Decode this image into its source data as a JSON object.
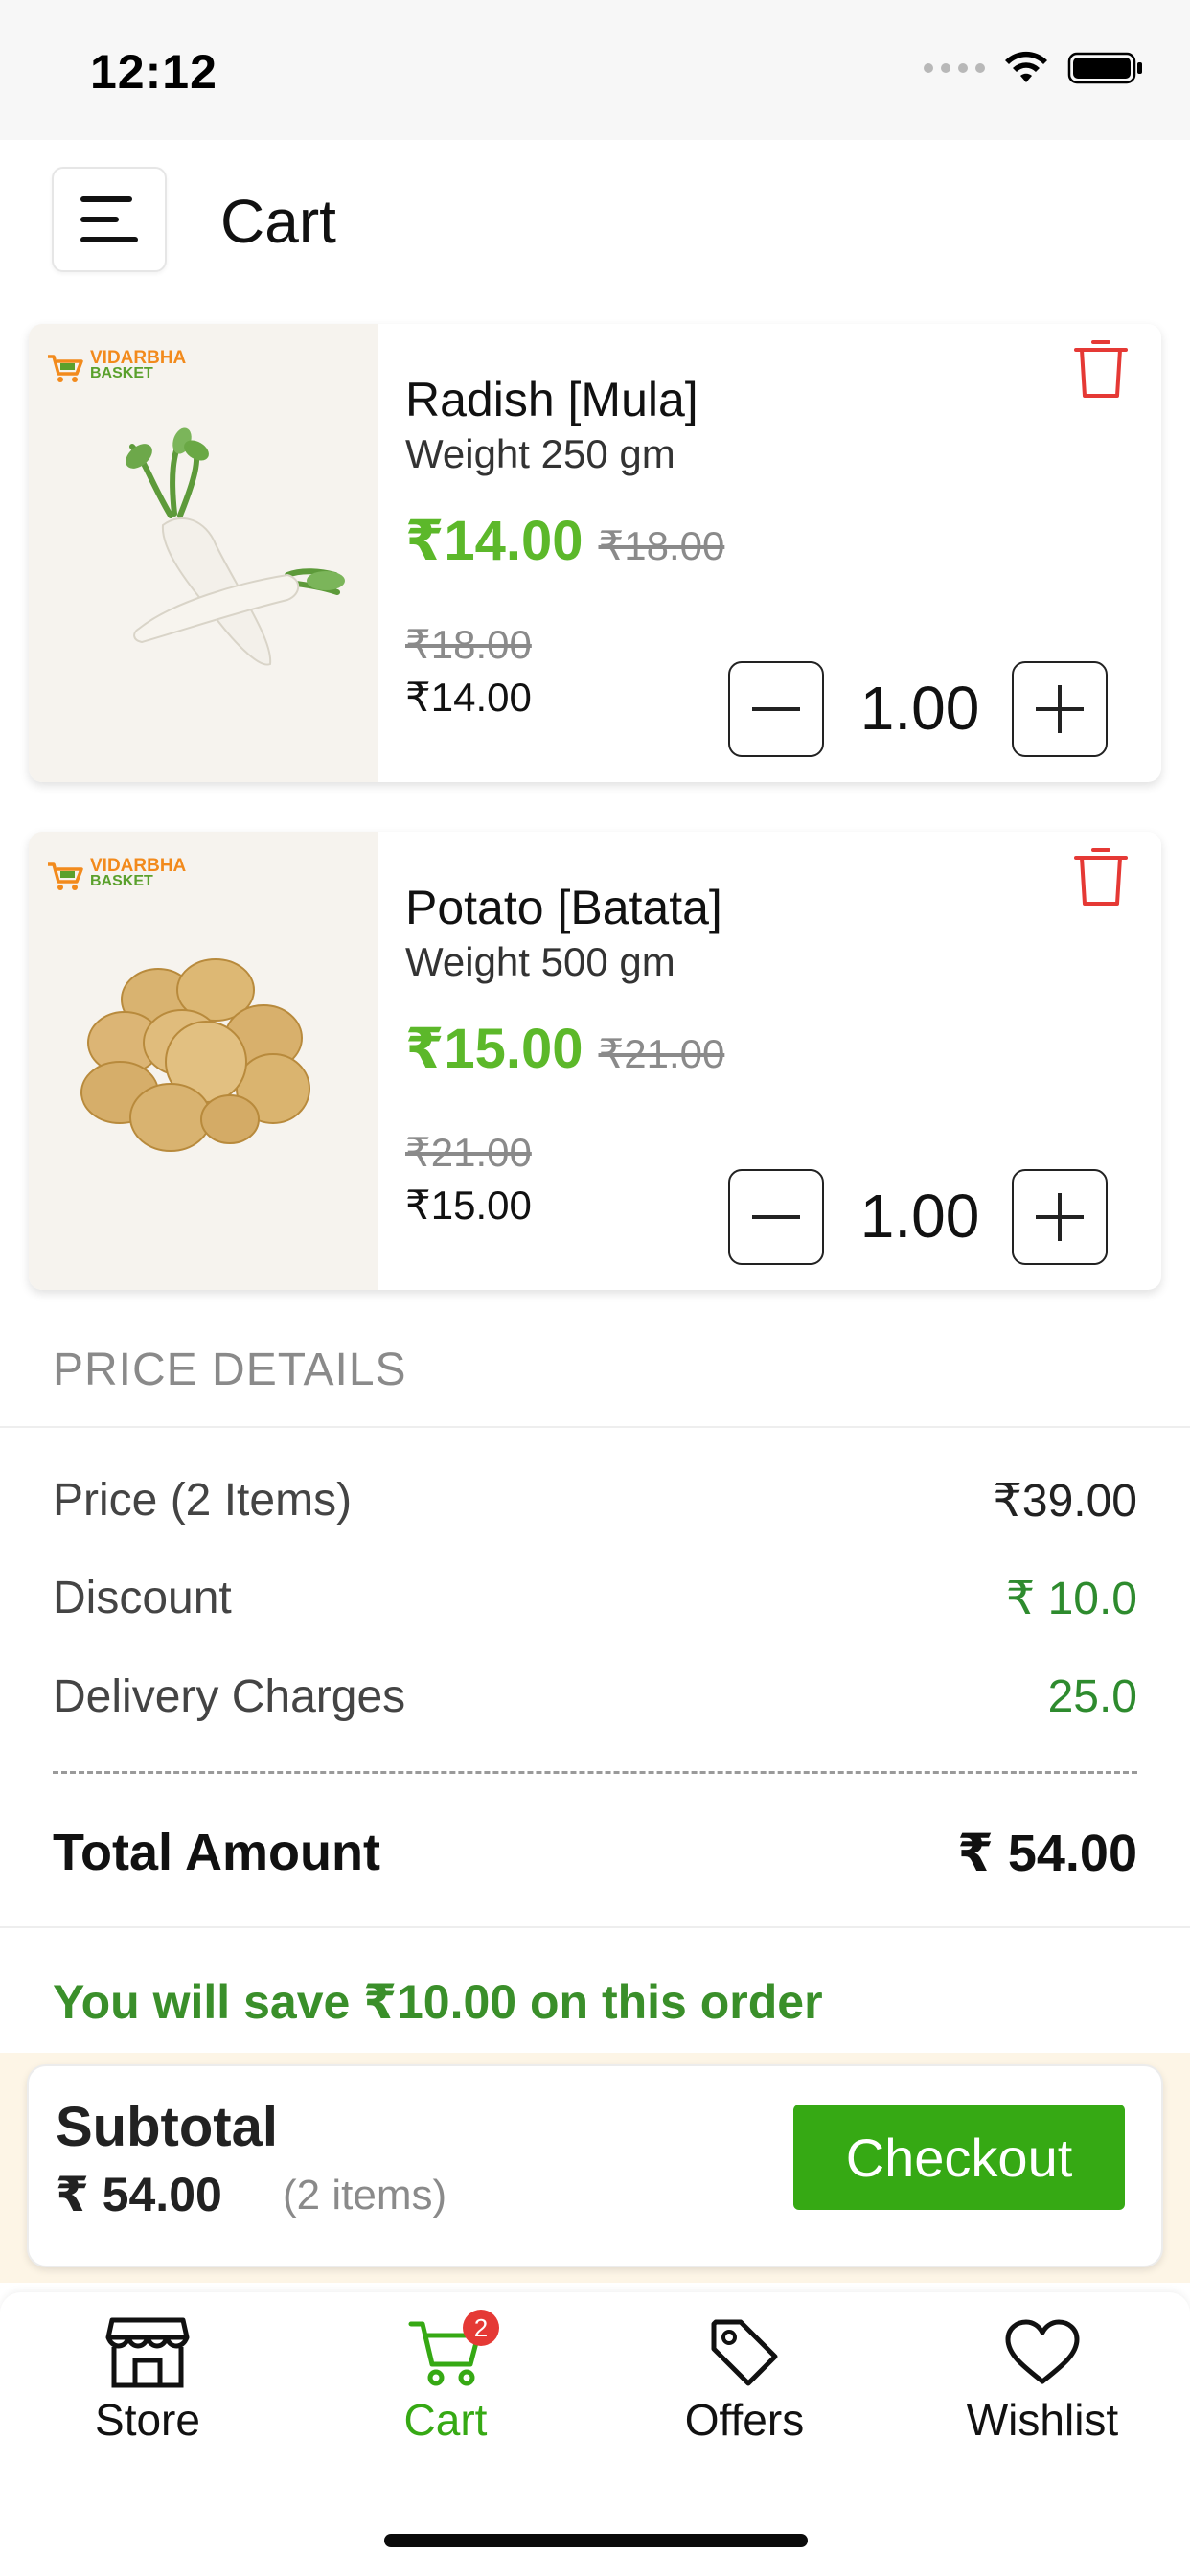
{
  "status_bar": {
    "time": "12:12"
  },
  "header": {
    "title": "Cart"
  },
  "cart_items": [
    {
      "brand_line1": "VIDARBHA",
      "brand_line2": "BASKET",
      "name": "Radish [Mula]",
      "weight": "Weight 250 gm",
      "price": "₹14.00",
      "mrp": "₹18.00",
      "mrp_small": "₹18.00",
      "price_small": "₹14.00",
      "quantity": "1.00",
      "image": "radish-image"
    },
    {
      "brand_line1": "VIDARBHA",
      "brand_line2": "BASKET",
      "name": "Potato [Batata]",
      "weight": "Weight 500 gm",
      "price": "₹15.00",
      "mrp": "₹21.00",
      "mrp_small": "₹21.00",
      "price_small": "₹15.00",
      "quantity": "1.00",
      "image": "potato-image"
    }
  ],
  "price_details": {
    "title": "PRICE DETAILS",
    "price_label": "Price (2 Items)",
    "price_value": "₹39.00",
    "discount_label": "Discount",
    "discount_value": "₹ 10.0",
    "delivery_label": "Delivery Charges",
    "delivery_value": "25.0",
    "total_label": "Total Amount",
    "total_value": "₹ 54.00",
    "savings_text": "You will save ₹10.00 on this order"
  },
  "subtotal": {
    "label": "Subtotal",
    "amount": "₹ 54.00",
    "items": "(2 items)",
    "checkout_label": "Checkout"
  },
  "tab_bar": {
    "tabs": [
      {
        "label": "Store",
        "icon": "store-icon"
      },
      {
        "label": "Cart",
        "icon": "cart-icon",
        "badge": "2",
        "active": true
      },
      {
        "label": "Offers",
        "icon": "tag-icon"
      },
      {
        "label": "Wishlist",
        "icon": "heart-icon"
      }
    ]
  },
  "colors": {
    "accent_green": "#36a914",
    "price_green": "#5cb82a",
    "savings_green": "#3a8f2a",
    "delete_red": "#e53935",
    "badge_red": "#e53935"
  }
}
